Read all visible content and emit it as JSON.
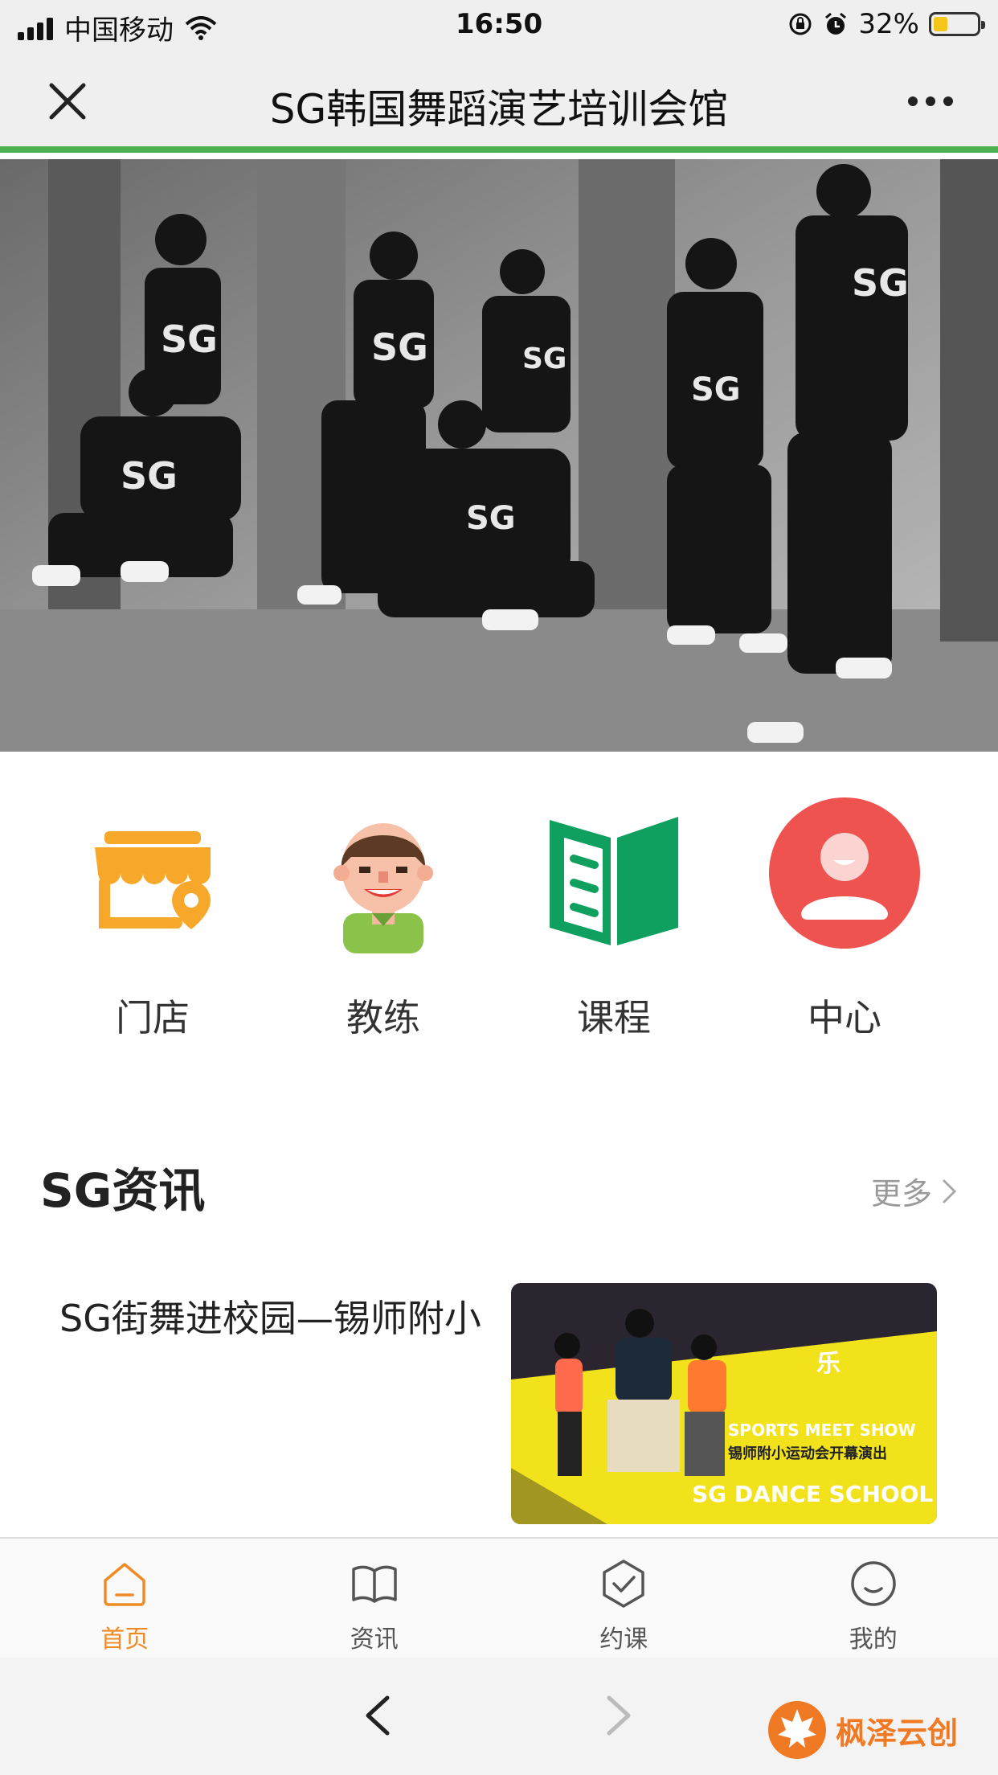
{
  "status_bar": {
    "carrier": "中国移动",
    "time": "16:50",
    "battery": "32%",
    "battery_level": 0.32
  },
  "nav": {
    "title": "SG韩国舞蹈演艺培训会馆"
  },
  "menu": [
    {
      "label": "门店",
      "icon": "store-icon"
    },
    {
      "label": "教练",
      "icon": "coach-icon"
    },
    {
      "label": "课程",
      "icon": "book-icon"
    },
    {
      "label": "中心",
      "icon": "user-center-icon"
    }
  ],
  "section": {
    "title": "SG资讯",
    "more": "更多"
  },
  "news": [
    {
      "title": "SG街舞进校园—锡师附小",
      "thumb_lines": [
        "SPORTS MEET SHOW",
        "锡师附小运动会开幕演出",
        "SG DANCE SCHOOL"
      ]
    }
  ],
  "tabs": [
    {
      "label": "首页",
      "icon": "home-icon",
      "active": true
    },
    {
      "label": "资讯",
      "icon": "book-open-icon",
      "active": false
    },
    {
      "label": "约课",
      "icon": "check-icon",
      "active": false
    },
    {
      "label": "我的",
      "icon": "smile-icon",
      "active": false
    }
  ],
  "watermark": "枫泽云创",
  "colors": {
    "accent": "#f08a24",
    "nav_border": "#4caf50",
    "store": "#f7a72a",
    "book": "#0fa060",
    "center": "#ef5350"
  }
}
